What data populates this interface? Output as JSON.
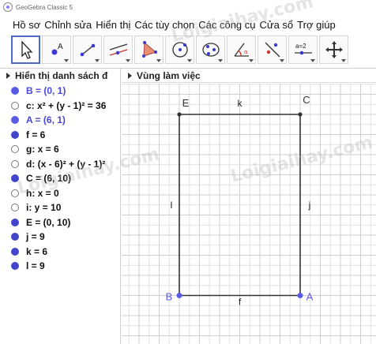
{
  "window": {
    "title": "GeoGebra Classic 5"
  },
  "menu": [
    "Hồ sơ",
    "Chỉnh sửa",
    "Hiển thị",
    "Các tùy chọn",
    "Các công cụ",
    "Cửa sổ",
    "Trợ giúp"
  ],
  "toolbar": {
    "tools": [
      {
        "icon": "move-arrow-icon"
      },
      {
        "icon": "point-icon",
        "label": "A"
      },
      {
        "icon": "line-icon"
      },
      {
        "icon": "parallel-lines-icon"
      },
      {
        "icon": "polygon-icon"
      },
      {
        "icon": "circle-icon"
      },
      {
        "icon": "conic-icon"
      },
      {
        "icon": "angle-icon"
      },
      {
        "icon": "reflect-icon"
      },
      {
        "icon": "slider-icon",
        "label": "a=2"
      },
      {
        "icon": "move-view-icon"
      }
    ]
  },
  "algebra": {
    "header": "Hiển thị danh sách đ",
    "rows": [
      {
        "text": "B = (0, 1)",
        "bullet": "filled-blue",
        "color": "txt-blue"
      },
      {
        "text": "c: x² + (y - 1)² = 36",
        "bullet": "empty",
        "color": "txt-black"
      },
      {
        "text": "A = (6, 1)",
        "bullet": "filled-blue",
        "color": "txt-blue"
      },
      {
        "text": "f = 6",
        "bullet": "filled-dark",
        "color": "txt-black"
      },
      {
        "text": "g: x = 6",
        "bullet": "empty",
        "color": "txt-black"
      },
      {
        "text": "d: (x - 6)² + (y - 1)²",
        "bullet": "empty",
        "color": "txt-black"
      },
      {
        "text": "C = (6, 10)",
        "bullet": "filled-dark",
        "color": "txt-black"
      },
      {
        "text": "h: x = 0",
        "bullet": "empty",
        "color": "txt-black"
      },
      {
        "text": "i: y = 10",
        "bullet": "empty",
        "color": "txt-black"
      },
      {
        "text": "E = (0, 10)",
        "bullet": "filled-dark",
        "color": "txt-black"
      },
      {
        "text": "j = 9",
        "bullet": "filled-dark",
        "color": "txt-black"
      },
      {
        "text": "k = 6",
        "bullet": "filled-dark",
        "color": "txt-black"
      },
      {
        "text": "l = 9",
        "bullet": "filled-dark",
        "color": "txt-black"
      }
    ]
  },
  "graphics": {
    "header": "Vùng làm việc",
    "points": [
      {
        "name": "B",
        "x": 0,
        "y": 1,
        "color": "#5a5ae8"
      },
      {
        "name": "A",
        "x": 6,
        "y": 1,
        "color": "#5a5ae8"
      },
      {
        "name": "C",
        "x": 6,
        "y": 10,
        "color": "#333333"
      },
      {
        "name": "E",
        "x": 0,
        "y": 10,
        "color": "#333333"
      }
    ],
    "segments": [
      {
        "name": "f",
        "from": "B",
        "to": "A"
      },
      {
        "name": "j",
        "from": "A",
        "to": "C"
      },
      {
        "name": "k",
        "from": "C",
        "to": "E"
      },
      {
        "name": "l",
        "from": "E",
        "to": "B"
      }
    ]
  },
  "watermarks": [
    "Loigiaihay.com",
    "Loigiaihay.com",
    "Loigiaihay.com"
  ]
}
